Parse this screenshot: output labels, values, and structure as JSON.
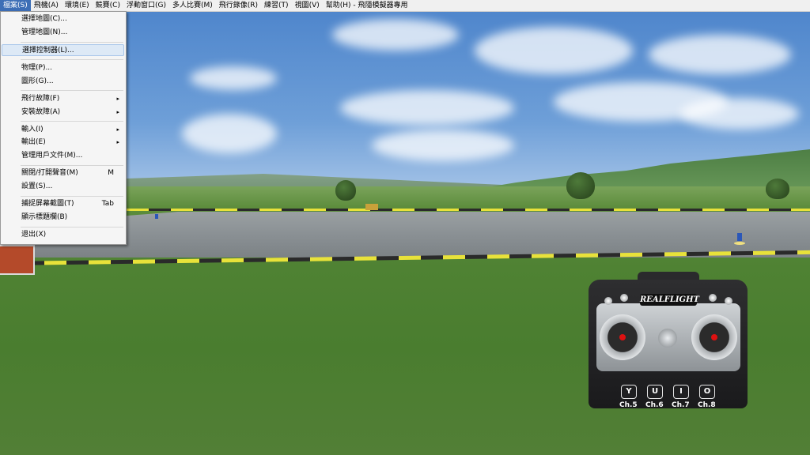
{
  "menubar": {
    "items": [
      {
        "label": "檔案(S)"
      },
      {
        "label": "飛機(A)"
      },
      {
        "label": "環境(E)"
      },
      {
        "label": "競賽(C)"
      },
      {
        "label": "浮動窗口(G)"
      },
      {
        "label": "多人比賽(M)"
      },
      {
        "label": "飛行錄像(R)"
      },
      {
        "label": "練習(T)"
      },
      {
        "label": "視圖(V)"
      },
      {
        "label": "幫助(H) - 飛隱模擬器專用"
      }
    ]
  },
  "file_menu": {
    "items": [
      {
        "label": "選擇地圖(C)..."
      },
      {
        "label": "管理地圖(N)..."
      },
      {
        "label": "選擇控制器(L)..."
      },
      {
        "label": "物理(P)..."
      },
      {
        "label": "圖形(G)..."
      },
      {
        "label": "飛行故障(F)"
      },
      {
        "label": "安裝故障(A)"
      },
      {
        "label": "輸入(I)"
      },
      {
        "label": "輸出(E)"
      },
      {
        "label": "管理用戶文件(M)..."
      },
      {
        "label": "關閉/打開聲音(M)",
        "shortcut": "M"
      },
      {
        "label": "設置(S)..."
      },
      {
        "label": "捕捉屏幕截圖(T)",
        "shortcut": "Tab"
      },
      {
        "label": "顯示標題欄(B)"
      },
      {
        "label": "退出(X)"
      }
    ],
    "submenu_arrow": "▸"
  },
  "transmitter": {
    "logo": "REALFLIGHT",
    "channels": [
      {
        "key": "Y",
        "label": "Ch.5"
      },
      {
        "key": "U",
        "label": "Ch.6"
      },
      {
        "key": "I",
        "label": "Ch.7"
      },
      {
        "key": "O",
        "label": "Ch.8"
      }
    ]
  },
  "colors": {
    "menu_highlight": "#3d6fb6",
    "hover_item": "#dde9f6",
    "grass": "#4f8233",
    "sky": "#6e9fd8"
  }
}
